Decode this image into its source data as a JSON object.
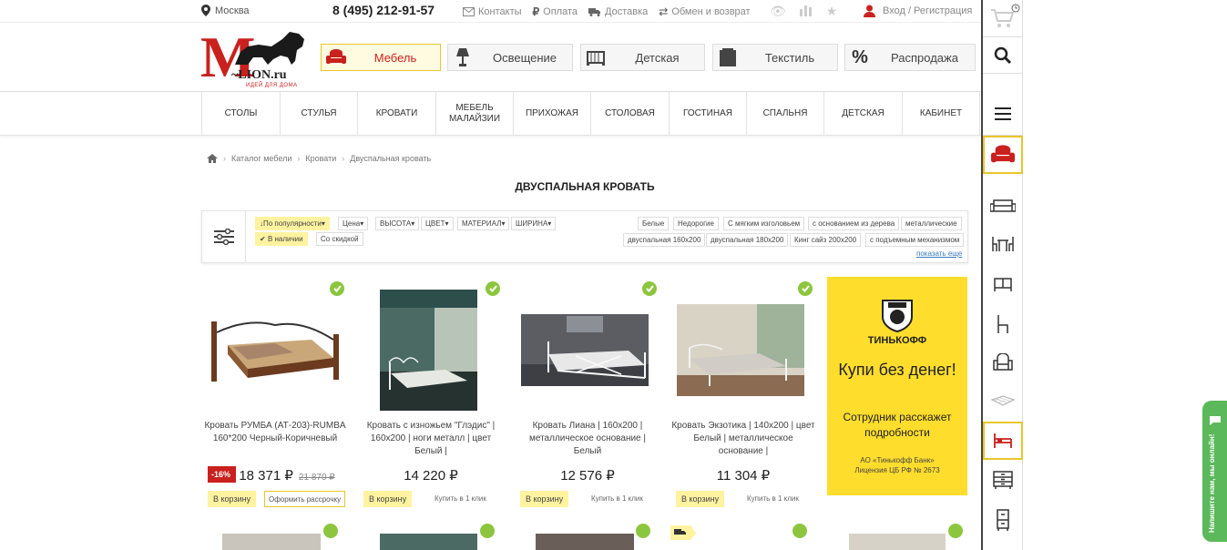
{
  "topbar": {
    "city": "Москва",
    "phone": "8 (495) 212-91-57",
    "links": [
      "Контакты",
      "Оплата",
      "Доставка",
      "Обмен и возврат"
    ],
    "login": "Вход / Регистрация"
  },
  "logo": {
    "letter": "M",
    "name": "~LION.ru",
    "slogan": "ИДЕЙ ДЛЯ ДОМА"
  },
  "categories": [
    "Мебель",
    "Освещение",
    "Детская",
    "Текстиль",
    "Распродажа"
  ],
  "nav": [
    "Столы",
    "Стулья",
    "Кровати",
    "Мебель Малайзии",
    "Прихожая",
    "Столовая",
    "Гостиная",
    "Спальня",
    "Детская",
    "Кабинет"
  ],
  "breadcrumb": [
    "Каталог мебели",
    "Кровати",
    "Двуспальная кровать"
  ],
  "page_title": "ДВУСПАЛЬНАЯ КРОВАТЬ",
  "filters": {
    "sort": "По популярности",
    "dropdowns": [
      "Цена",
      "ВЫСОТА",
      "ЦВЕТ",
      "МАТЕРИАЛ",
      "ШИРИНА"
    ],
    "in_stock": "В наличии",
    "discount": "Со скидкой",
    "tags_row1": [
      "Белые",
      "Недорогие",
      "С мягким изголовьем",
      "с основанием из дерева",
      "металлические"
    ],
    "tags_row2": [
      "двуспальная 160х200",
      "двуспальная 180х200",
      "Кинг сайз 200х200",
      "с подъемным механизмом"
    ],
    "show_more": "показать еще"
  },
  "products": [
    {
      "name": "Кровать РУМБА (АТ-203)-RUMBA 160*200 Черный-Коричневый",
      "price": "18 371 ₽",
      "old_price": "21 870 ₽",
      "discount": "-16%",
      "buy": "В корзину",
      "credit": "Оформить рассрочку"
    },
    {
      "name": "Кровать с изножьем \"Глэдис\" | 160х200 | ноги металл | цвет Белый |",
      "price": "14 220 ₽",
      "buy": "В корзину",
      "oneclick": "Купить в 1 клик"
    },
    {
      "name": "Кровать Лиана | 160х200 | металлическое основание | Белый",
      "price": "12 576 ₽",
      "buy": "В корзину",
      "oneclick": "Купить в 1 клик"
    },
    {
      "name": "Кровать Экзотика | 140х200 | цвет Белый | металлическое основание |",
      "price": "11 304 ₽",
      "buy": "В корзину",
      "oneclick": "Купить в 1 клик"
    }
  ],
  "banner": {
    "brand": "ТИНЬКОФФ",
    "title": "Купи без денег!",
    "text": "Сотрудник расскажет подробности",
    "legal_1": "АО «Тинькофф Банк»",
    "legal_2": "Лицензия ЦБ РФ № 2673"
  },
  "chat": "Напишите нам, мы онлайн!",
  "colors": {
    "accent_red": "#c9211e",
    "accent_yellow": "#ffdd2d",
    "check_green": "#8cc63f",
    "chat_green": "#5bb85b"
  },
  "icons": [
    "map-pin-icon",
    "mail-icon",
    "ruble-icon",
    "truck-icon",
    "exchange-icon",
    "eye-icon",
    "chart-icon",
    "star-icon",
    "user-icon",
    "cart-icon",
    "search-icon",
    "menu-icon",
    "armchair-icon",
    "sofa-icon",
    "dining-icon",
    "cabinet-icon",
    "chair-icon",
    "soft-chair-icon",
    "mattress-icon",
    "bed-icon",
    "dresser-icon",
    "wardrobe-icon",
    "home-icon",
    "filter-icon",
    "check-icon"
  ]
}
